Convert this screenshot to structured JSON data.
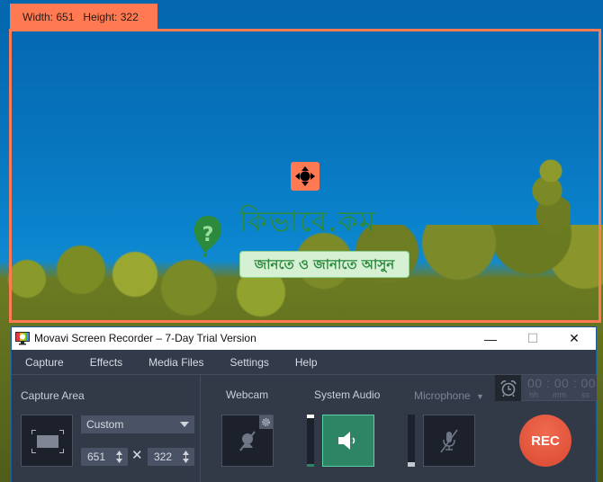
{
  "capture_overlay": {
    "dimensions_label": "Width: 651   Height: 322",
    "frame_color": "#ff7a53"
  },
  "watermark": {
    "title": "কিভাবে.কম",
    "tagline": "জানতে ও জানাতে আসুন",
    "color": "#2c8a3c"
  },
  "window": {
    "title": "Movavi Screen Recorder – 7-Day Trial Version",
    "controls": {
      "minimize": "—",
      "maximize": "☐",
      "close": "✕"
    }
  },
  "menu": {
    "items": [
      "Capture",
      "Effects",
      "Media Files",
      "Settings",
      "Help"
    ]
  },
  "capture_panel": {
    "label": "Capture Area",
    "preset": "Custom",
    "width": "651",
    "height": "322",
    "times_sign": "✕"
  },
  "sources": {
    "webcam_label": "Webcam",
    "system_audio_label": "System Audio",
    "microphone_label": "Microphone",
    "system_audio_enabled": true,
    "webcam_enabled": false,
    "microphone_enabled": false,
    "system_audio_level": 0.05,
    "microphone_level": 0.08,
    "active_color": "#2e8565"
  },
  "recorder": {
    "timer": "00 : 00 : 00",
    "units": [
      "hh",
      "mm",
      "ss"
    ],
    "rec_label": "REC",
    "rec_color": "#e0533a"
  }
}
